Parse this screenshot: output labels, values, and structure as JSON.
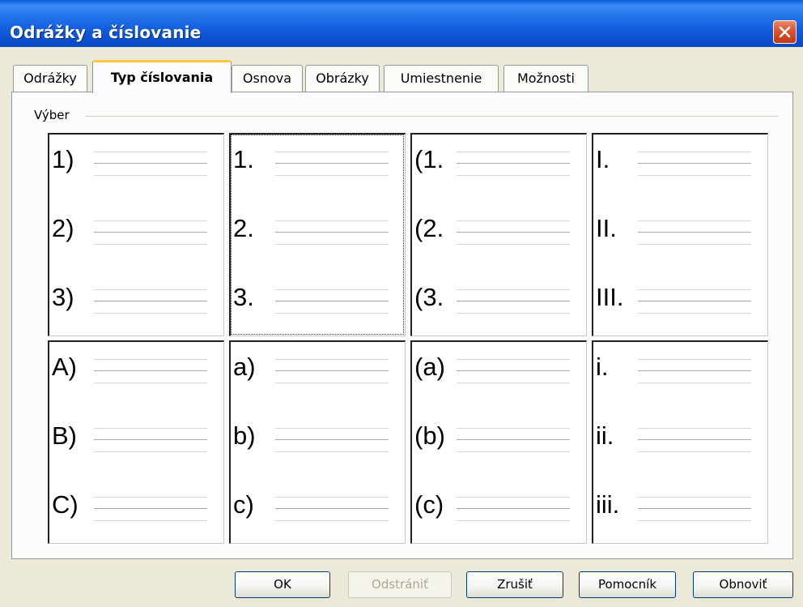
{
  "window": {
    "title": "Odrážky a číslovanie",
    "close_icon": "close-icon"
  },
  "tabs": [
    {
      "label": "Odrážky",
      "active": false
    },
    {
      "label": "Typ číslovania",
      "active": true
    },
    {
      "label": "Osnova",
      "active": false
    },
    {
      "label": "Obrázky",
      "active": false
    },
    {
      "label": "Umiestnenie",
      "active": false
    },
    {
      "label": "Možnosti",
      "active": false
    }
  ],
  "group": {
    "label": "Výber"
  },
  "styles": [
    {
      "items": [
        "1)",
        "2)",
        "3)"
      ],
      "selected": false
    },
    {
      "items": [
        "1.",
        "2.",
        "3."
      ],
      "selected": true
    },
    {
      "items": [
        "(1.",
        "(2.",
        "(3."
      ],
      "selected": false
    },
    {
      "items": [
        "I.",
        "II.",
        "III."
      ],
      "selected": false
    },
    {
      "items": [
        "A)",
        "B)",
        "C)"
      ],
      "selected": false
    },
    {
      "items": [
        "a)",
        "b)",
        "c)"
      ],
      "selected": false
    },
    {
      "items": [
        "(a)",
        "(b)",
        "(c)"
      ],
      "selected": false
    },
    {
      "items": [
        "i.",
        "ii.",
        "iii."
      ],
      "selected": false
    }
  ],
  "buttons": {
    "ok": "OK",
    "remove": "Odstrániť",
    "cancel": "Zrušiť",
    "help": "Pomocník",
    "reset": "Obnoviť"
  },
  "colors": {
    "titlebar": "#0a55d4",
    "dialog_bg": "#ece9d8",
    "tab_highlight": "#ffc73c",
    "close_button": "#d9532f"
  }
}
